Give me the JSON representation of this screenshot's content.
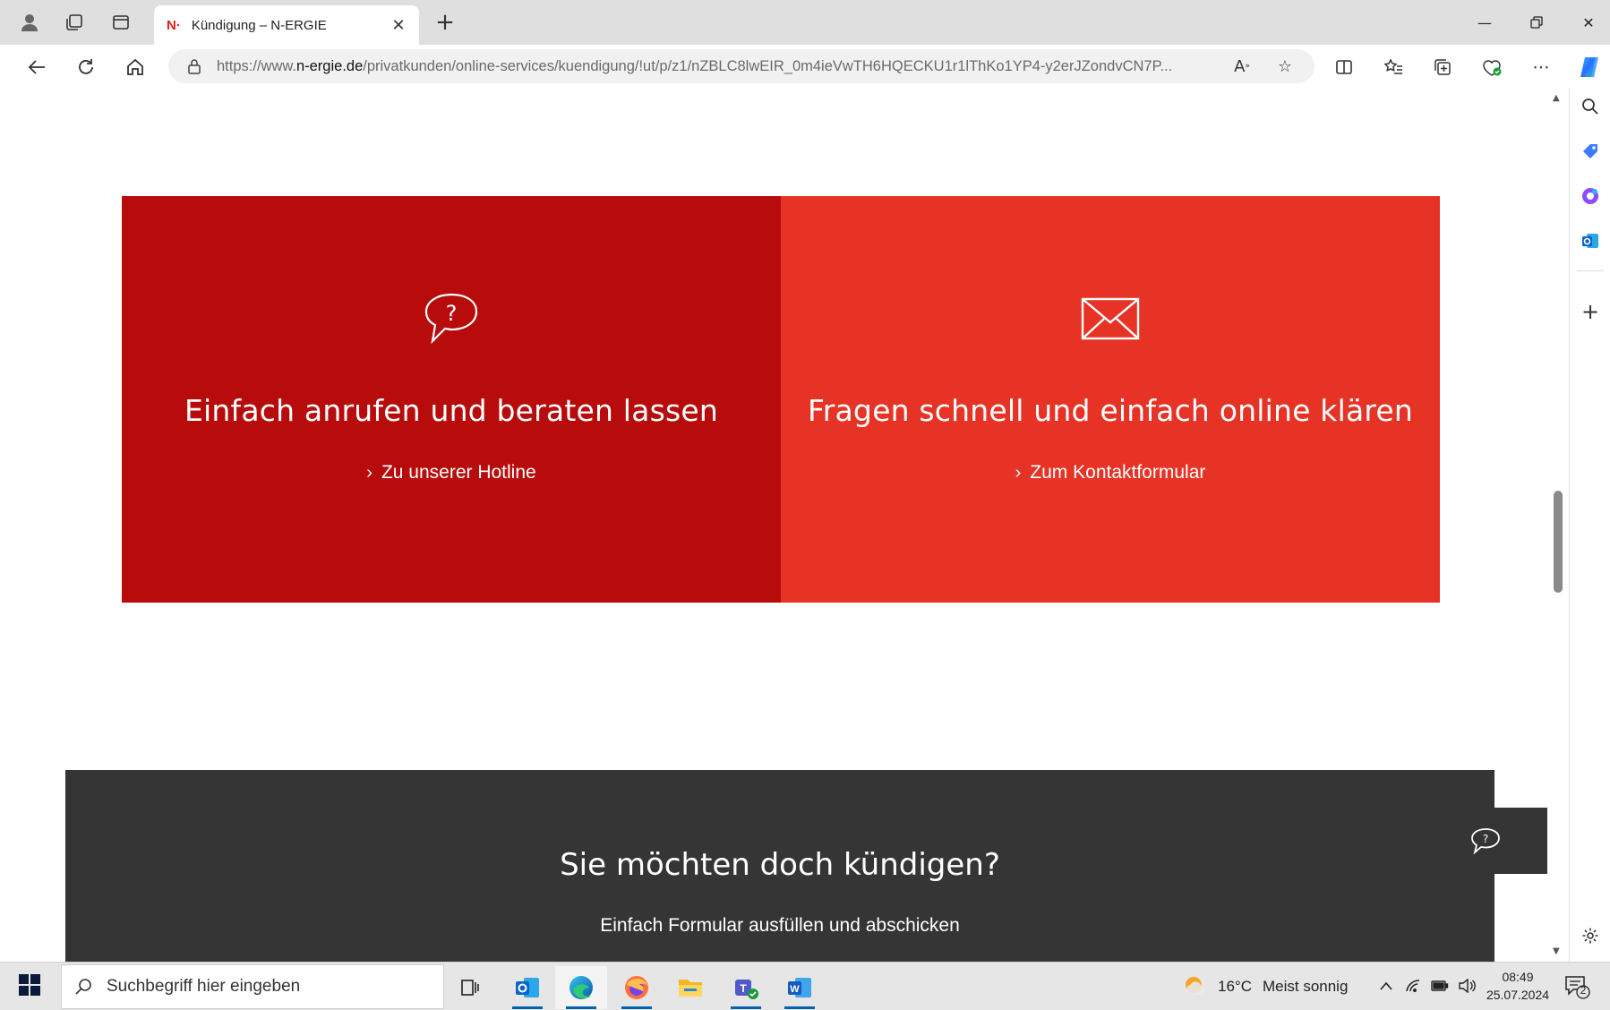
{
  "browser": {
    "tab": {
      "favicon": "N·",
      "title": "Kündigung – N-ERGIE"
    },
    "url_prefix": "https://www.",
    "url_host": "n-ergie.de",
    "url_path": "/privatkunden/online-services/kuendigung/!ut/p/z1/nZBLC8lwEIR_0m4ieVwTH6HQECKU1r1lThKo1YP4-y2erJZondvCN7P..."
  },
  "cards": [
    {
      "title": "Einfach anrufen und beraten lassen",
      "link": "Zu unserer Hotline",
      "icon": "chat-question-icon"
    },
    {
      "title": "Fragen schnell und einfach online klären",
      "link": "Zum Kontaktformular",
      "icon": "envelope-icon"
    }
  ],
  "cancel_section": {
    "title": "Sie möchten doch kündigen?",
    "subtitle": "Einfach Formular ausfüllen und abschicken"
  },
  "taskbar": {
    "search_placeholder": "Suchbegriff hier eingeben",
    "weather_temp": "16°C",
    "weather_text": "Meist sonnig",
    "time": "08:49",
    "date": "25.07.2024",
    "notification_count": "2"
  },
  "colors": {
    "card_left": "#b80c0c",
    "card_right": "#e63325",
    "dark_section": "#353535"
  }
}
